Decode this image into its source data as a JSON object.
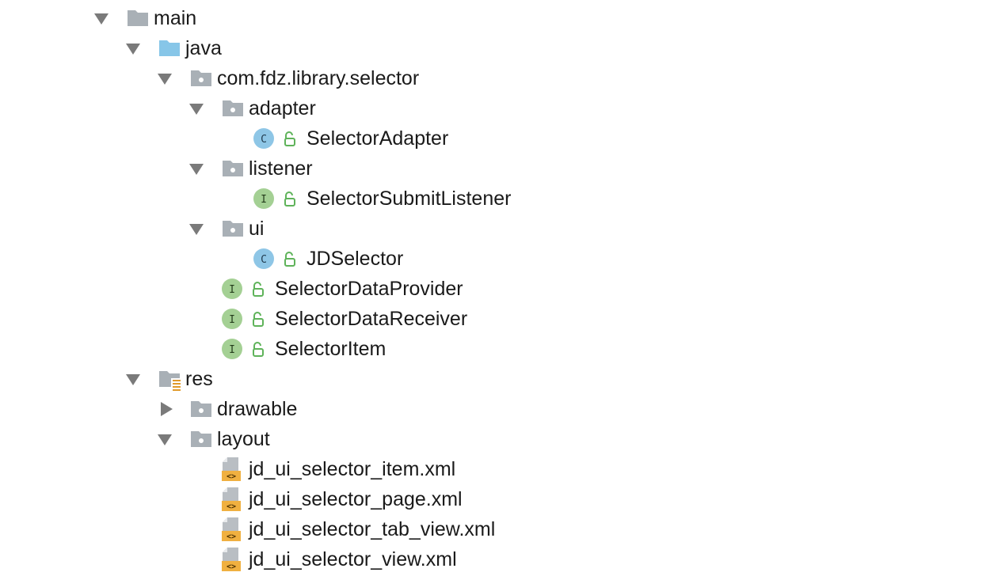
{
  "tree": {
    "items": [
      {
        "label": "main",
        "icon": "folder-icon",
        "expanded": true
      },
      {
        "label": "java",
        "icon": "source-folder-icon",
        "expanded": true
      },
      {
        "label": "com.fdz.library.selector",
        "icon": "package-icon",
        "expanded": true
      },
      {
        "label": "adapter",
        "icon": "package-icon",
        "expanded": true
      },
      {
        "label": "SelectorAdapter",
        "icon": "class-icon",
        "badge": "C"
      },
      {
        "label": "listener",
        "icon": "package-icon",
        "expanded": true
      },
      {
        "label": "SelectorSubmitListener",
        "icon": "interface-icon",
        "badge": "I"
      },
      {
        "label": "ui",
        "icon": "package-icon",
        "expanded": true
      },
      {
        "label": "JDSelector",
        "icon": "class-icon",
        "badge": "C"
      },
      {
        "label": "SelectorDataProvider",
        "icon": "interface-icon",
        "badge": "I"
      },
      {
        "label": "SelectorDataReceiver",
        "icon": "interface-icon",
        "badge": "I"
      },
      {
        "label": "SelectorItem",
        "icon": "interface-icon",
        "badge": "I"
      },
      {
        "label": "res",
        "icon": "resource-folder-icon",
        "expanded": true
      },
      {
        "label": "drawable",
        "icon": "package-icon",
        "expanded": false
      },
      {
        "label": "layout",
        "icon": "package-icon",
        "expanded": true
      },
      {
        "label": "jd_ui_selector_item.xml",
        "icon": "xml-file-icon"
      },
      {
        "label": "jd_ui_selector_page.xml",
        "icon": "xml-file-icon"
      },
      {
        "label": "jd_ui_selector_tab_view.xml",
        "icon": "xml-file-icon"
      },
      {
        "label": "jd_ui_selector_view.xml",
        "icon": "xml-file-icon"
      }
    ]
  },
  "colors": {
    "folder": "#a9b0b6",
    "source_folder": "#87c6e8",
    "class_badge": "#8ec6e6",
    "interface_badge": "#a4d094",
    "public_lock": "#5fb35a",
    "xml_tag": "#f0b040",
    "arrow": "#7a7a7a"
  }
}
